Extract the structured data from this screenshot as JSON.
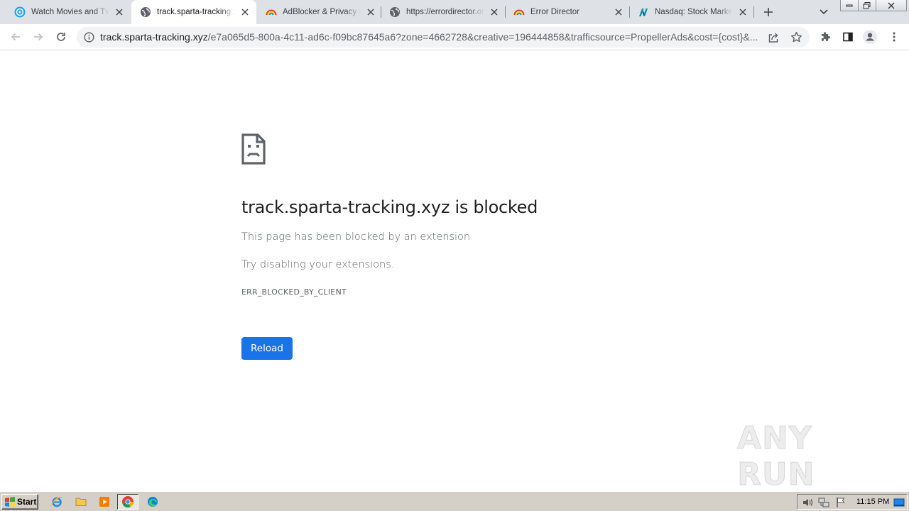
{
  "browser": {
    "tabs": [
      {
        "title": "Watch Movies and Tv Shows",
        "icon": "circle-play-icon",
        "active": false
      },
      {
        "title": "track.sparta-tracking.xyz",
        "icon": "globe-icon",
        "active": true
      },
      {
        "title": "AdBlocker & Privacy Protection",
        "icon": "rainbow-icon",
        "active": false
      },
      {
        "title": "https://errordirector.online",
        "icon": "globe-icon",
        "active": false
      },
      {
        "title": "Error Director",
        "icon": "rainbow-icon",
        "active": false
      },
      {
        "title": "Nasdaq: Stock Market, Data",
        "icon": "nasdaq-icon",
        "active": false
      }
    ],
    "address": {
      "host": "track.sparta-tracking.xyz",
      "path": "/e7a065d5-800a-4c11-ad6c-f09bc87645a6?zone=4662728&creative=196444858&trafficsource=PropellerAds&cost={cost}&..."
    }
  },
  "error_page": {
    "title": "track.sparta-tracking.xyz is blocked",
    "message": "This page has been blocked by an extension",
    "suggestion": "Try disabling your extensions.",
    "code": "ERR_BLOCKED_BY_CLIENT",
    "reload_label": "Reload"
  },
  "watermark": {
    "text": "ANY RUN"
  },
  "taskbar": {
    "start_label": "Start",
    "clock": "11:15 PM"
  },
  "colors": {
    "accent": "#1a73e8",
    "tabstrip_bg": "#dee1e6",
    "taskbar_bg": "#d4d0c8"
  }
}
